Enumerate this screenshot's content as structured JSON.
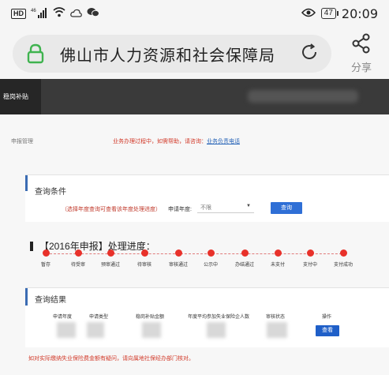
{
  "statusbar": {
    "network": "HD",
    "signal": "46",
    "battery": "47",
    "time": "20:09"
  },
  "browser": {
    "title": "佛山市人力资源和社会保障局",
    "share_label": "分享"
  },
  "nav": {
    "active_tab": "稳岗补贴"
  },
  "breadcrumb": {
    "text": "申报管理",
    "notice": "业务办理过程中，如需帮助，请咨询：",
    "notice_link": "业务负责电话"
  },
  "query": {
    "title": "查询条件",
    "hint": "（选择年度查询可查看该年度处理进度）",
    "year_label": "申请年度:",
    "year_value": "不限",
    "button": "查询"
  },
  "progress": {
    "title": "【2016年申报】处理进度：",
    "steps": [
      "暂存",
      "待受审",
      "预审通过",
      "待审核",
      "审核通过",
      "公示中",
      "办结通过",
      "未支付",
      "支付中",
      "支付成功"
    ]
  },
  "results": {
    "title": "查询结果",
    "headers": [
      "申请年度",
      "申请类型",
      "稳岗补贴金额",
      "年度平均参加失业保险企人数",
      "审核状态",
      "操作"
    ],
    "action_button": "查看"
  },
  "footer": {
    "note": "如对实际缴纳失业保险费金额有疑问，请向属地社保经办部门核对。"
  },
  "colors": {
    "accent_blue": "#2f6fd6",
    "notice_red": "#d23a2a",
    "step_dot": "#e8312a",
    "lock_green": "#3fb34f"
  }
}
